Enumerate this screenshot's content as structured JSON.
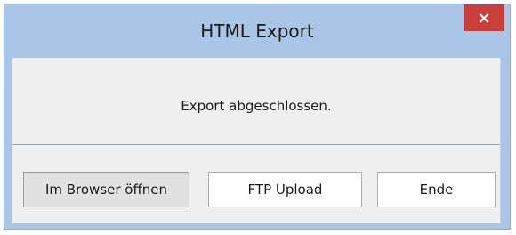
{
  "window": {
    "title": "HTML Export",
    "close_icon": "×"
  },
  "content": {
    "message": "Export abgeschlossen."
  },
  "buttons": {
    "open_browser": "Im Browser öffnen",
    "ftp_upload": "FTP Upload",
    "end": "Ende"
  },
  "colors": {
    "titlebar": "#a9c6e6",
    "close_button": "#c9403a",
    "client_bg": "#efefef"
  }
}
